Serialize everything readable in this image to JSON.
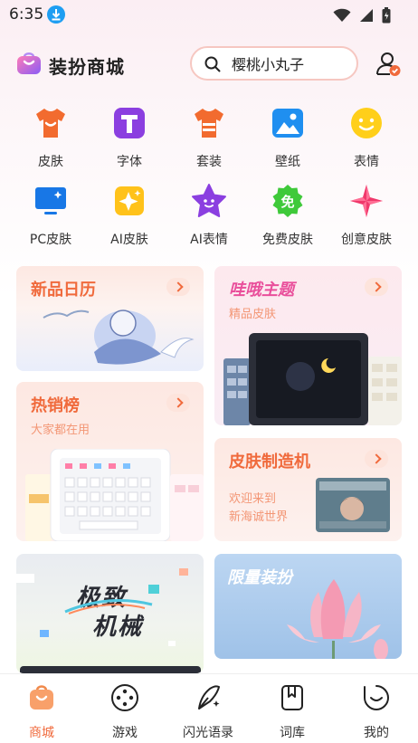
{
  "status_bar": {
    "time": "6:35"
  },
  "header": {
    "title": "装扮商城",
    "search_value": "樱桃小丸子"
  },
  "categories": [
    {
      "label": "皮肤",
      "icon": "shirt-icon"
    },
    {
      "label": "字体",
      "icon": "font-t-icon"
    },
    {
      "label": "套装",
      "icon": "suit-icon"
    },
    {
      "label": "壁纸",
      "icon": "wallpaper-icon"
    },
    {
      "label": "表情",
      "icon": "emoji-icon"
    },
    {
      "label": "PC皮肤",
      "icon": "monitor-icon"
    },
    {
      "label": "AI皮肤",
      "icon": "ai-star-icon"
    },
    {
      "label": "AI表情",
      "icon": "star-face-icon"
    },
    {
      "label": "免费皮肤",
      "icon": "free-badge-icon"
    },
    {
      "label": "创意皮肤",
      "icon": "pinwheel-icon"
    }
  ],
  "cards": {
    "new_calendar": {
      "title": "新品日历"
    },
    "wow_theme": {
      "title": "哇哦主题",
      "subtitle": "精品皮肤"
    },
    "hot_list": {
      "title": "热销榜",
      "subtitle": "大家都在用"
    },
    "skin_maker": {
      "title": "皮肤制造机",
      "subtitle_line1": "欢迎来到",
      "subtitle_line2": "新海诚世界"
    },
    "mechanical": {
      "title_line1": "极致",
      "title_line2": "机械"
    },
    "limited": {
      "title": "限量装扮"
    }
  },
  "bottom_nav": [
    {
      "label": "商城",
      "icon": "mall-bag-icon",
      "active": true
    },
    {
      "label": "游戏",
      "icon": "gamepad-icon",
      "active": false
    },
    {
      "label": "闪光语录",
      "icon": "quill-icon",
      "active": false
    },
    {
      "label": "词库",
      "icon": "bookmark-book-icon",
      "active": false
    },
    {
      "label": "我的",
      "icon": "smile-profile-icon",
      "active": false
    }
  ],
  "colors": {
    "accent": "#f06a3c",
    "search_border": "#f6c7c1"
  }
}
